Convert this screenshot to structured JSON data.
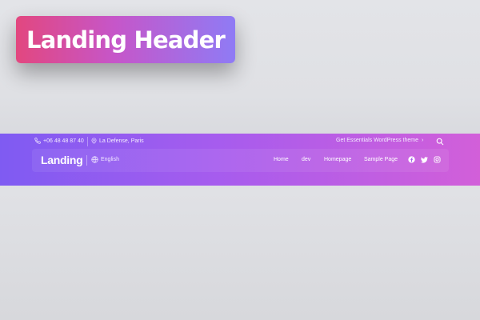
{
  "badge": {
    "title": "Landing Header"
  },
  "topbar": {
    "phone": "+06 48 48 87 40",
    "location": "La Defense, Paris",
    "promo": "Get Essentials WordPress theme",
    "promo_arrow": "›"
  },
  "navbar": {
    "logo": "Landing",
    "language": "English",
    "links": [
      "Home",
      "dev",
      "Homepage",
      "Sample Page"
    ],
    "social": [
      "facebook-icon",
      "twitter-icon",
      "instagram-icon"
    ]
  },
  "colors": {
    "badge_gradient": [
      "#e2477f",
      "#c656c9",
      "#8f7bf5"
    ],
    "header_gradient": [
      "#7f5bf2",
      "#a65cee",
      "#d25fd9"
    ],
    "page_bg": "#e0e1e5"
  }
}
